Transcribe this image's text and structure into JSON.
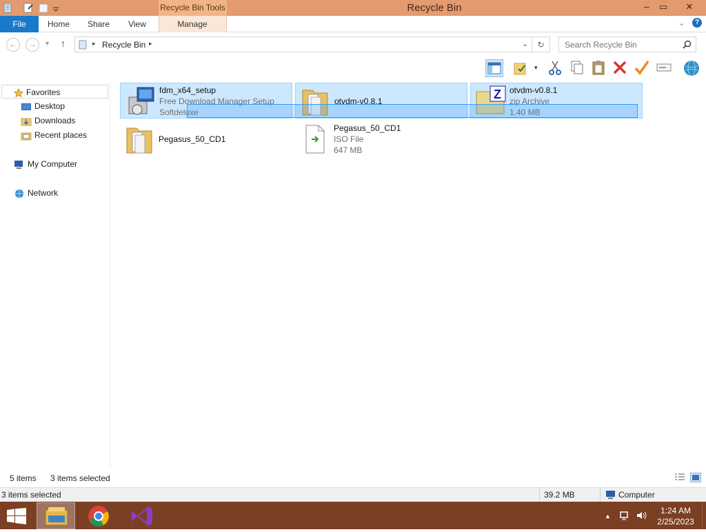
{
  "window": {
    "title": "Recycle Bin",
    "context_tab": "Recycle Bin Tools",
    "controls": {
      "minimize": "–",
      "maximize": "▭",
      "close": "✕"
    }
  },
  "ribbon": {
    "tabs": [
      "File",
      "Home",
      "Share",
      "View",
      "Manage"
    ]
  },
  "address": {
    "path": "Recycle Bin",
    "search_placeholder": "Search Recycle Bin"
  },
  "nav": {
    "favorites": "Favorites",
    "items": [
      "Desktop",
      "Downloads",
      "Recent places"
    ],
    "computer": "My Computer",
    "network": "Network"
  },
  "files": [
    {
      "name": "fdm_x64_setup",
      "line2": "Free Download Manager Setup",
      "line3": "Softdeluxe",
      "icon": "installer-icon",
      "selected": true
    },
    {
      "name": "otvdm-v0.8.1",
      "line2": "",
      "line3": "",
      "icon": "folder-icon",
      "selected": true
    },
    {
      "name": "otvdm-v0.8.1",
      "line2": "zip Archive",
      "line3": "1.40 MB",
      "icon": "zip-archive-icon",
      "selected": true
    },
    {
      "name": "Pegasus_50_CD1",
      "line2": "",
      "line3": "",
      "icon": "folder-icon",
      "selected": false
    },
    {
      "name": "Pegasus_50_CD1",
      "line2": "ISO File",
      "line3": "647 MB",
      "icon": "iso-file-icon",
      "selected": false
    }
  ],
  "status": {
    "items": "5 items",
    "selected": "3 items selected",
    "bottom_selected": "3 items selected",
    "size": "39.2 MB",
    "location": "Computer"
  },
  "taskbar": {
    "time": "1:24 AM",
    "date": "2/25/2023"
  }
}
